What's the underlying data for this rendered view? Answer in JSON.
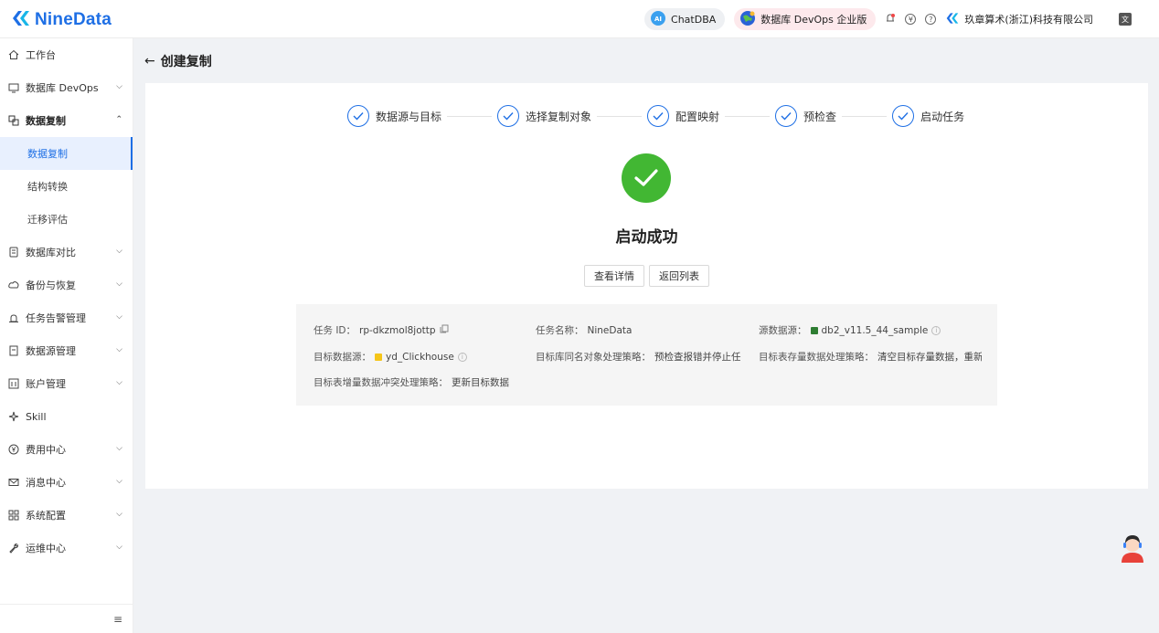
{
  "header": {
    "logo_text": "NineData",
    "chatdba_label": "ChatDBA",
    "devops_label": "数据库 DevOps 企业版",
    "company_name": "玖章算术(浙江)科技有限公司",
    "brand_color": "#1e6fe5"
  },
  "sidebar": {
    "items": [
      {
        "label": "工作台",
        "icon": "home-icon"
      },
      {
        "label": "数据库 DevOps",
        "icon": "monitor-icon"
      },
      {
        "label": "数据复制",
        "icon": "replicate-icon"
      },
      {
        "label": "数据库对比",
        "icon": "compare-icon"
      },
      {
        "label": "备份与恢复",
        "icon": "backup-icon"
      },
      {
        "label": "任务告警管理",
        "icon": "alarm-icon"
      },
      {
        "label": "数据源管理",
        "icon": "datasource-icon"
      },
      {
        "label": "账户管理",
        "icon": "account-icon"
      },
      {
        "label": "Skill",
        "icon": "skill-icon"
      },
      {
        "label": "费用中心",
        "icon": "yen-icon"
      },
      {
        "label": "消息中心",
        "icon": "mail-icon"
      },
      {
        "label": "系统配置",
        "icon": "grid-icon"
      },
      {
        "label": "运维中心",
        "icon": "wrench-icon"
      }
    ],
    "sub_items": [
      {
        "label": "数据复制"
      },
      {
        "label": "结构转换"
      },
      {
        "label": "迁移评估"
      }
    ]
  },
  "page": {
    "title": "创建复制"
  },
  "steps": [
    {
      "label": "数据源与目标"
    },
    {
      "label": "选择复制对象"
    },
    {
      "label": "配置映射"
    },
    {
      "label": "预检查"
    },
    {
      "label": "启动任务"
    }
  ],
  "result": {
    "title": "启动成功",
    "view_details_label": "查看详情",
    "back_to_list_label": "返回列表",
    "success_color": "#42b733"
  },
  "task_info": {
    "task_id_label": "任务 ID：",
    "task_id_value": "rp-dkzmol8jottp",
    "task_name_label": "任务名称：",
    "task_name_value": "NineData",
    "source_label": "源数据源：",
    "source_value": "db2_v11.5_44_sample",
    "target_label": "目标数据源：",
    "target_value": "yd_Clickhouse",
    "same_name_label": "目标库同名对象处理策略：",
    "same_name_value": "预检查报错并停止任务",
    "existing_data_label": "目标表存量数据处理策略：",
    "existing_data_value": "清空目标存量数据，重新写入",
    "conflict_label": "目标表增量数据冲突处理策略：",
    "conflict_value": "更新目标数据"
  }
}
